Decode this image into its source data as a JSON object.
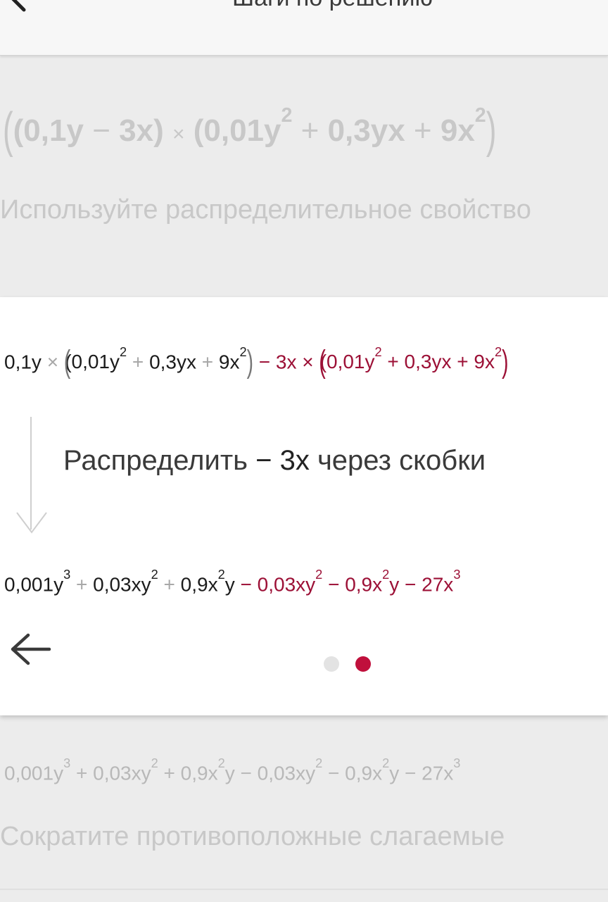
{
  "header": {
    "title": "Шаги по решению",
    "back_icon": "arrow-left-icon"
  },
  "step1": {
    "a": "(0,1y",
    "minus": "−",
    "b": "3x)",
    "times": "×",
    "c": "(0,01y",
    "c_exp": "2",
    "plus1": "+",
    "d": "0,3yx",
    "plus2": "+",
    "e": "9x",
    "e_exp": "2",
    "close": ")",
    "description": "Используйте распределительное свойство"
  },
  "card": {
    "line1": {
      "t1": "0,1y",
      "x1": "×",
      "p1": "(0,01y",
      "e1": "2",
      "op1": "+",
      "t2": "0,3yx",
      "op2": "+",
      "t3": "9x",
      "e2": "2",
      "c1": ")",
      "r1": "− 3x ×",
      "r2": "(0,01y",
      "r_e1": "2",
      "r3": "+ 0,3yx + 9x",
      "r_e2": "2",
      "r4": ")"
    },
    "instruction_pre": "Распределить",
    "instruction_term": "− 3x",
    "instruction_post": "через скобки",
    "line2": {
      "a": "0,001y",
      "a_e": "3",
      "op1": "+",
      "b": "0,03xy",
      "b_e": "2",
      "op2": "+",
      "c": "0,9x",
      "c_e": "2",
      "c2": "y",
      "r1": "− 0,03xy",
      "r1_e": "2",
      "r2": "− 0,9x",
      "r2_e": "2",
      "r3": "y − 27x",
      "r3_e": "3"
    },
    "back_icon": "arrow-left-icon",
    "page_indicator": {
      "current": 2,
      "total": 2
    },
    "colors": {
      "accent": "#c0103c",
      "highlight": "#9c1036"
    }
  },
  "step3": {
    "a": "0,001y",
    "a_e": "3",
    "b": "+ 0,03xy",
    "b_e": "2",
    "c": "+ 0,9x",
    "c_e": "2",
    "d": "y − 0,03xy",
    "d_e": "2",
    "e": "− 0,9x",
    "e_e": "2",
    "f": "y − 27x",
    "f_e": "3",
    "description": "Сократите противоположные слагаемые"
  }
}
